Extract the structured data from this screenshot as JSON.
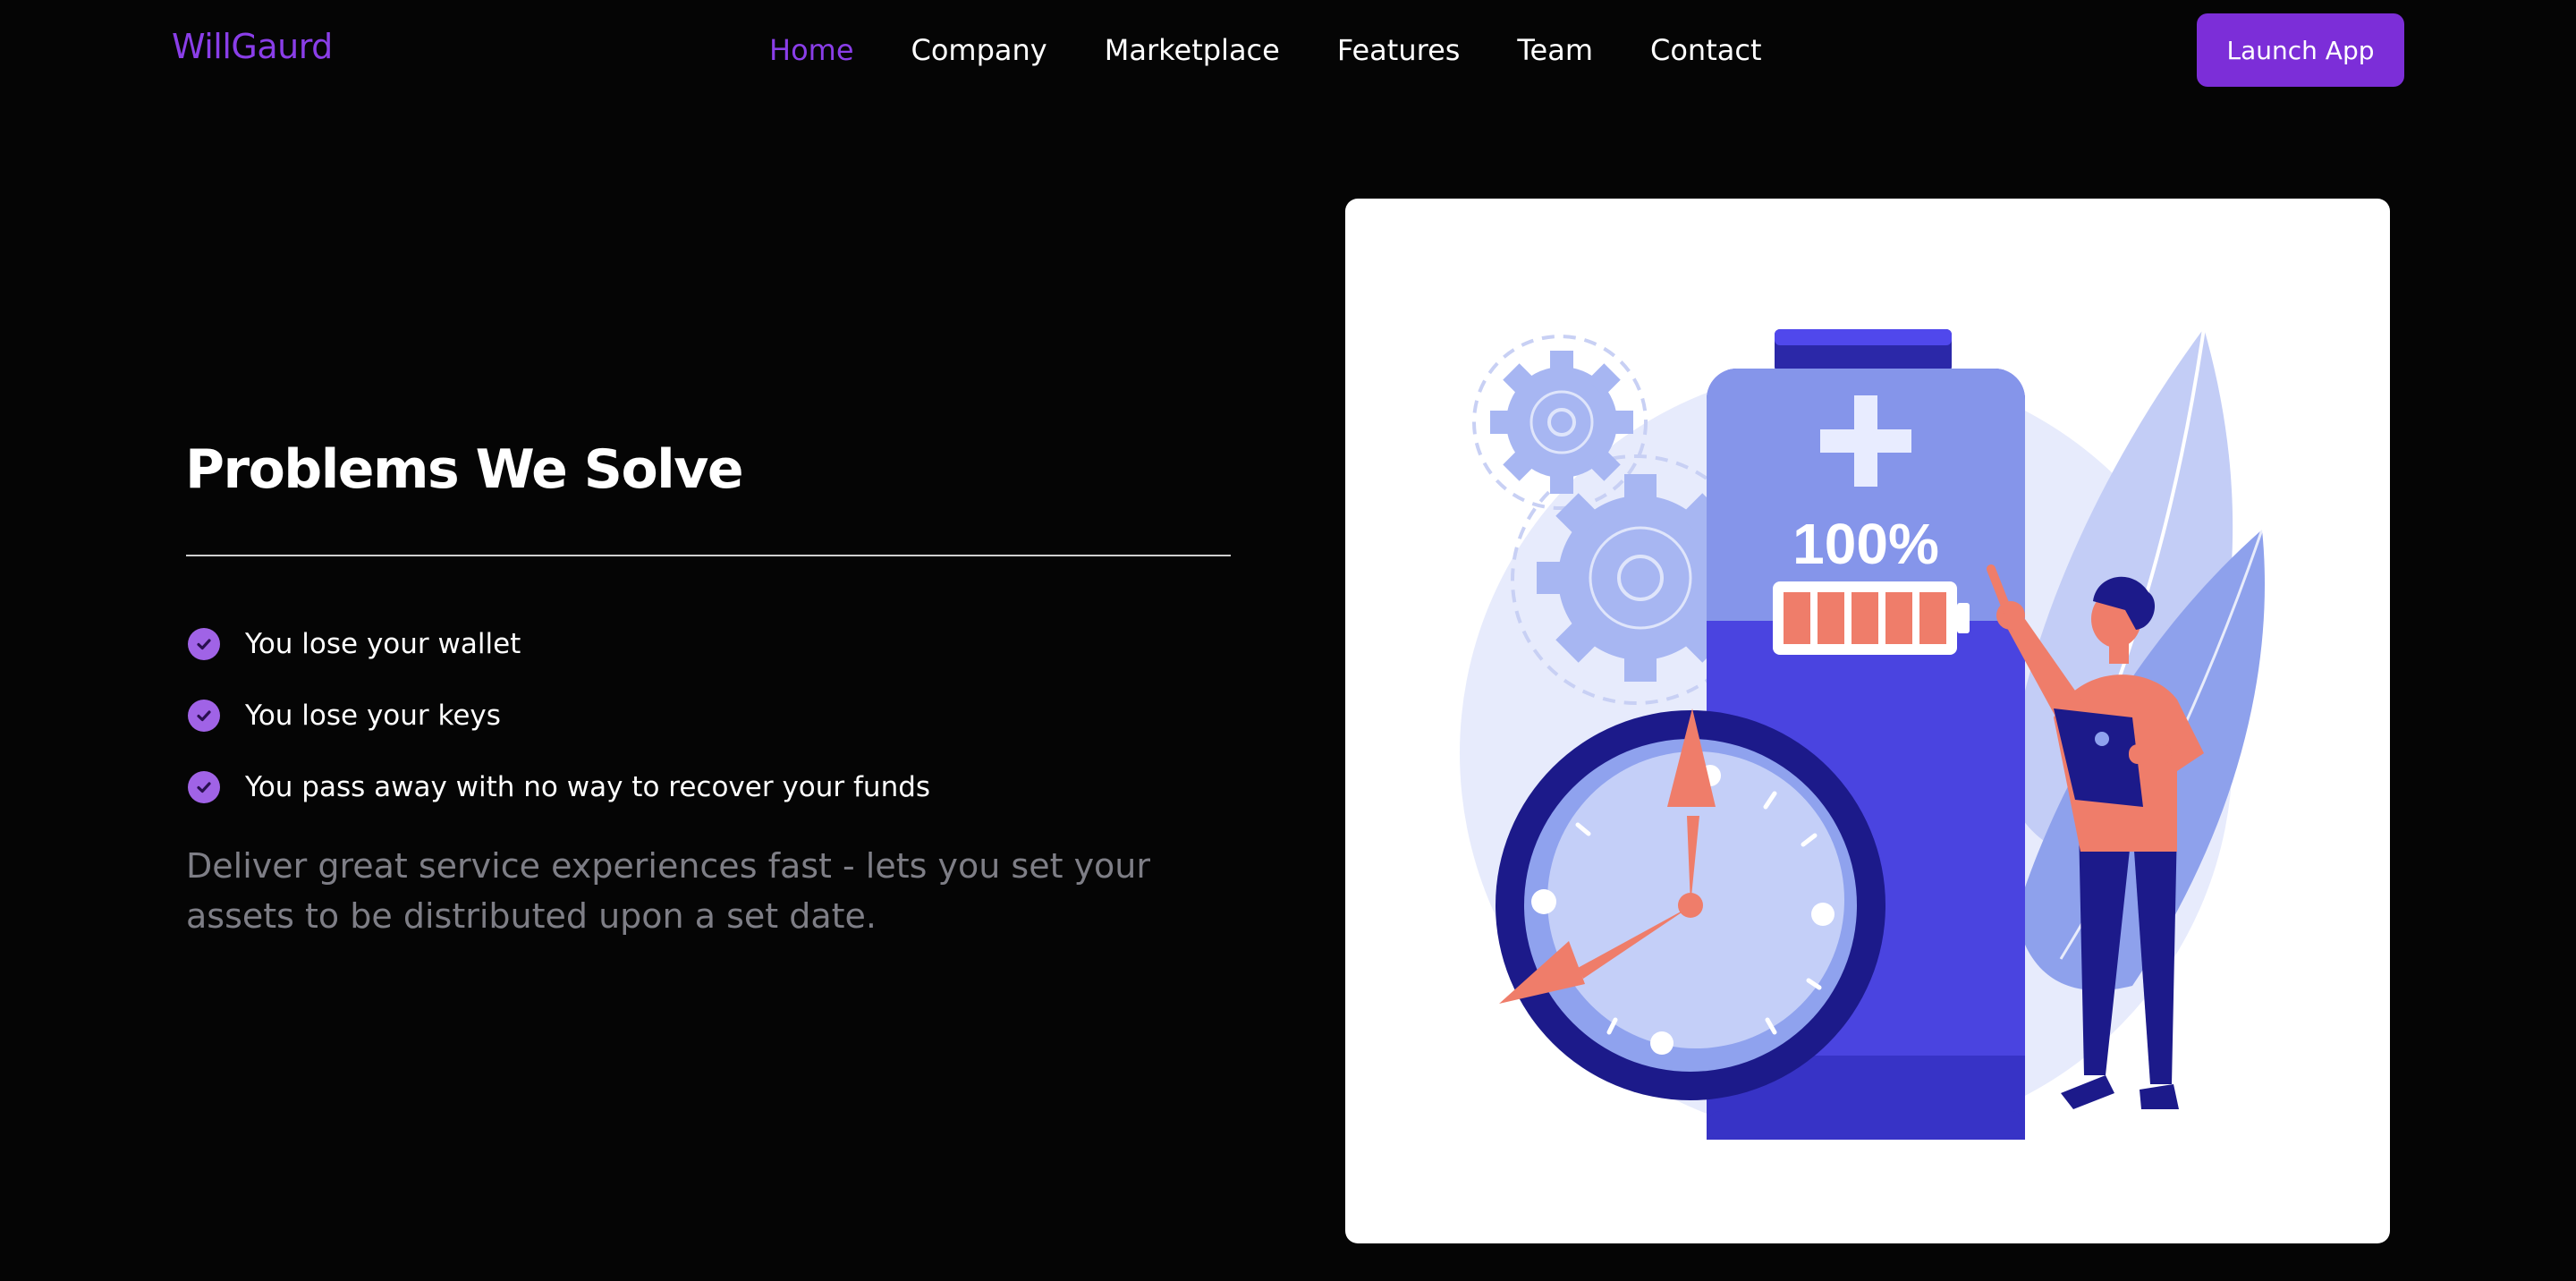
{
  "brand": "WillGaurd",
  "nav": {
    "items": [
      "Home",
      "Company",
      "Marketplace",
      "Features",
      "Team",
      "Contact"
    ],
    "active": "Home"
  },
  "launch_button": "Launch App",
  "section": {
    "title": "Problems We Solve",
    "features": [
      "You lose your wallet",
      "You lose your keys",
      "You pass away with no way to recover your funds"
    ],
    "description": "Deliver great service experiences fast - lets you set your assets to be distributed upon a set date."
  },
  "illustration": {
    "battery_label": "100%",
    "battery_level": 1.0,
    "icons": [
      "battery-icon",
      "clock-icon",
      "gear-icon",
      "person-icon",
      "leaf-icon"
    ]
  },
  "colors": {
    "accent": "#8a3ee8",
    "button": "#7c2ed8",
    "background": "#050505",
    "battery_blue": "#4a44e0",
    "coral": "#ef7d6a",
    "navy": "#1c1a8a"
  }
}
